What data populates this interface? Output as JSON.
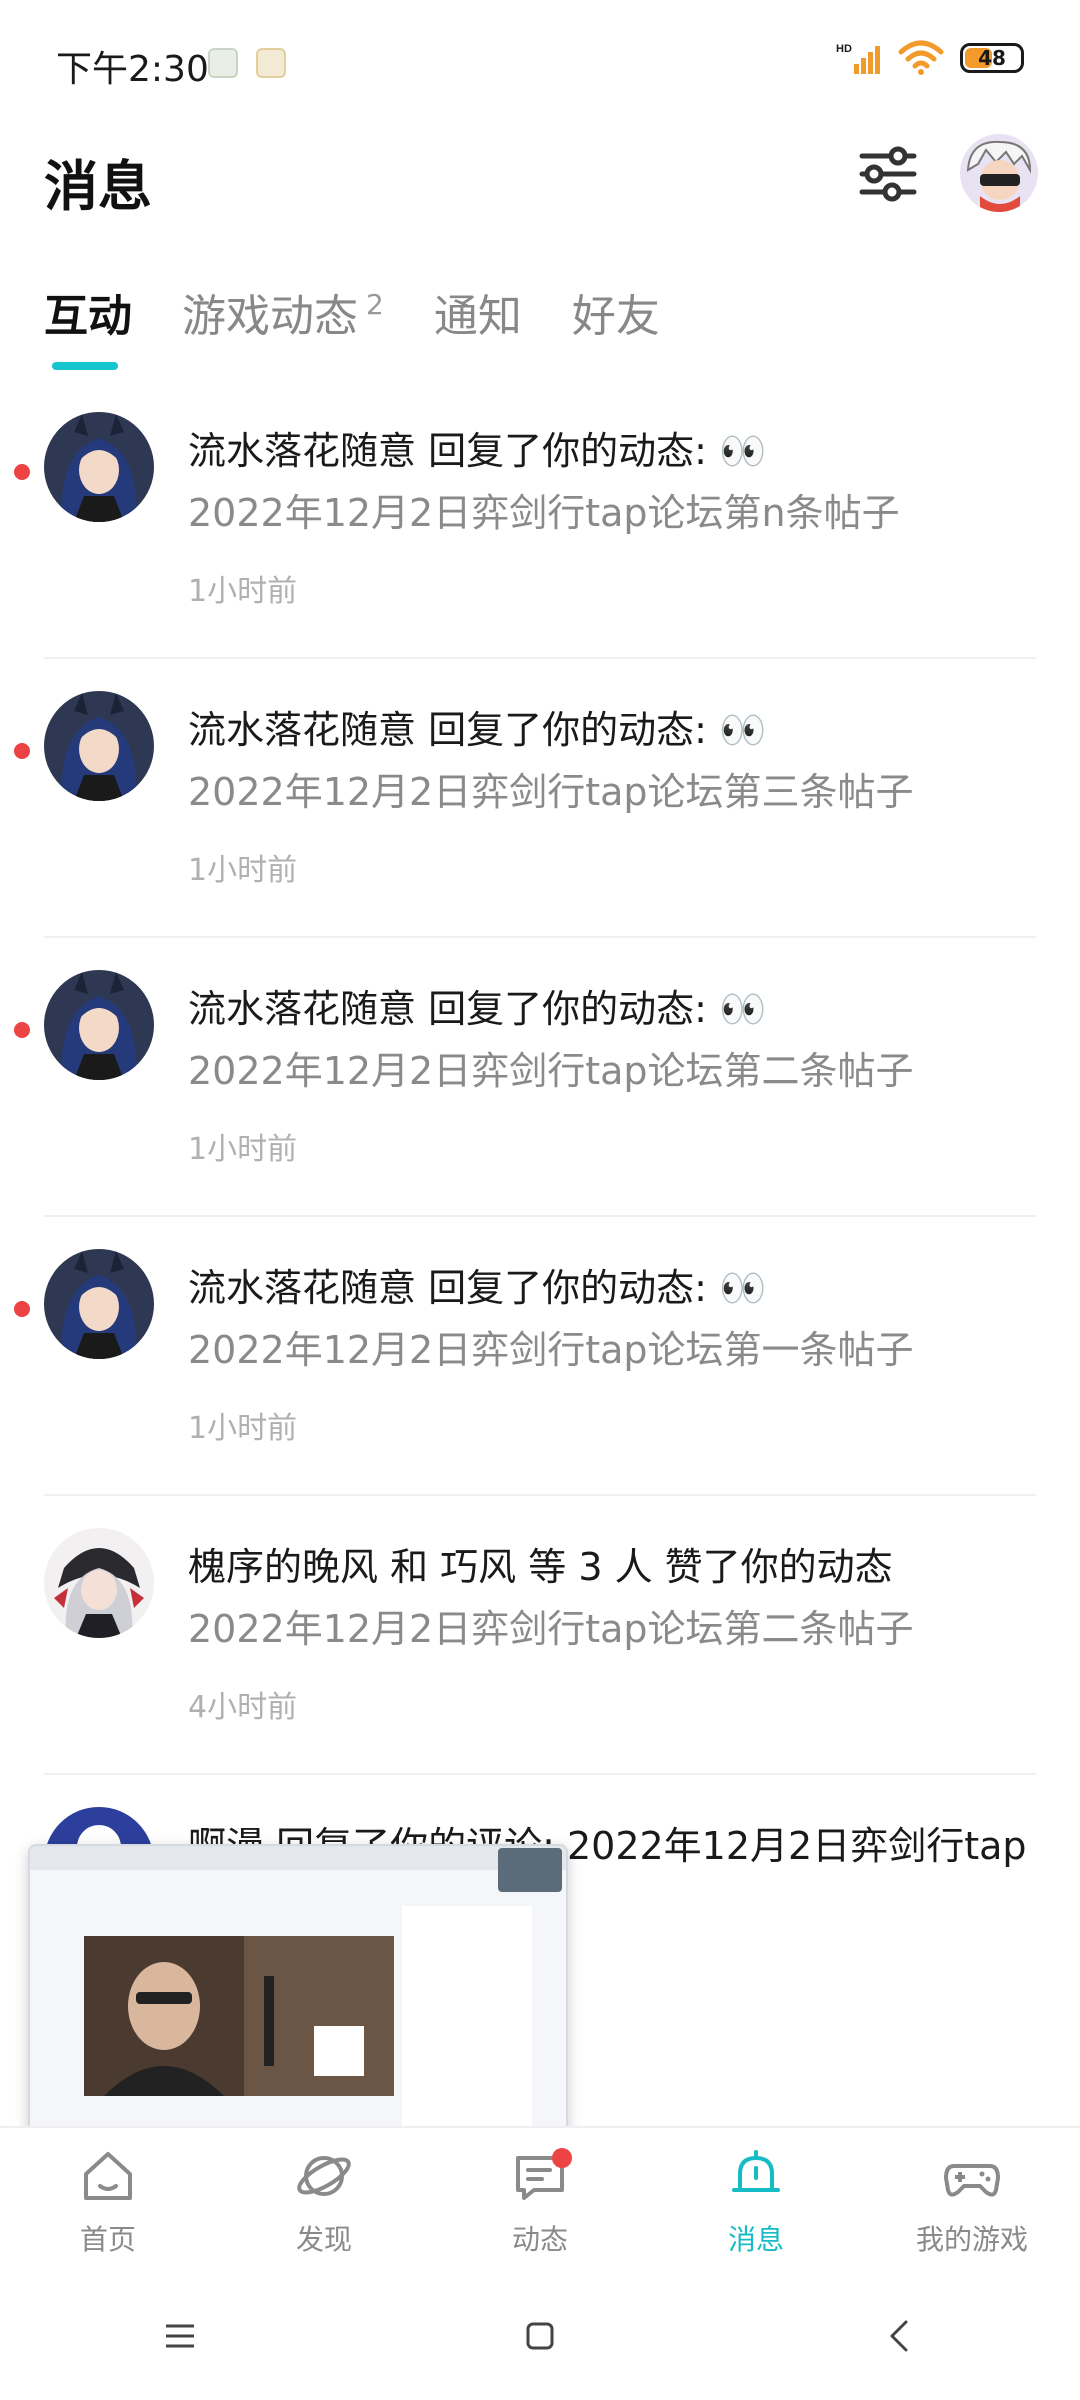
{
  "status_bar": {
    "time": "下午2:30",
    "network_label": "HD",
    "battery": "48"
  },
  "header": {
    "title": "消息"
  },
  "tabs": [
    {
      "label": "互动",
      "count": ""
    },
    {
      "label": "游戏动态",
      "count": "2"
    },
    {
      "label": "通知",
      "count": ""
    },
    {
      "label": "好友",
      "count": ""
    }
  ],
  "items": [
    {
      "title": "流水落花随意 回复了你的动态: 👀",
      "subtitle": "2022年12月2日弈剑行tap论坛第n条帖子",
      "time": "1小时前",
      "unread": true
    },
    {
      "title": "流水落花随意 回复了你的动态: 👀",
      "subtitle": "2022年12月2日弈剑行tap论坛第三条帖子",
      "time": "1小时前",
      "unread": true
    },
    {
      "title": "流水落花随意 回复了你的动态: 👀",
      "subtitle": "2022年12月2日弈剑行tap论坛第二条帖子",
      "time": "1小时前",
      "unread": true
    },
    {
      "title": "流水落花随意 回复了你的动态: 👀",
      "subtitle": "2022年12月2日弈剑行tap论坛第一条帖子",
      "time": "1小时前",
      "unread": true
    },
    {
      "title": "槐序的晚风 和 巧风 等 3 人 赞了你的动态",
      "subtitle": "2022年12月2日弈剑行tap论坛第二条帖子",
      "time": "4小时前",
      "unread": false
    },
    {
      "title": "啊漫 回复了你的评论: 2022年12月2日弈剑行tap",
      "subtitle": "",
      "time": "",
      "unread": false
    }
  ],
  "bottom_nav": [
    {
      "label": "首页",
      "icon": "home-icon"
    },
    {
      "label": "发现",
      "icon": "discover-icon"
    },
    {
      "label": "动态",
      "icon": "feed-icon"
    },
    {
      "label": "消息",
      "icon": "bell-icon"
    },
    {
      "label": "我的游戏",
      "icon": "gamepad-icon"
    }
  ],
  "colors": {
    "accent": "#15bcc6",
    "unread": "#ee4343"
  }
}
